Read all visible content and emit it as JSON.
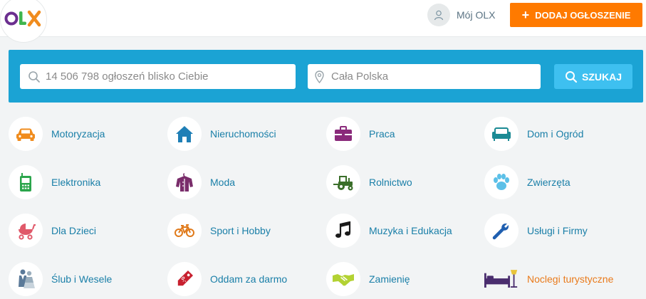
{
  "header": {
    "logo_text": "OLX",
    "my_olx_label": "Mój OLX",
    "add_button_label": "DODAJ OGŁOSZENIE",
    "add_button_plus": "+"
  },
  "search": {
    "query_placeholder": "14 506 798 ogłoszeń blisko Ciebie",
    "location_placeholder": "Cała Polska",
    "button_label": "SZUKAJ"
  },
  "colors": {
    "brand_orange": "#ff7a00",
    "search_bar": "#1ba3d4",
    "search_button": "#3ec0f0",
    "category_link": "#1a7fa8"
  },
  "categories": [
    {
      "label": "Motoryzacja",
      "icon": "car-icon"
    },
    {
      "label": "Nieruchomości",
      "icon": "house-icon"
    },
    {
      "label": "Praca",
      "icon": "briefcase-icon"
    },
    {
      "label": "Dom i Ogród",
      "icon": "sofa-icon"
    },
    {
      "label": "Elektronika",
      "icon": "phone-icon"
    },
    {
      "label": "Moda",
      "icon": "shirt-icon"
    },
    {
      "label": "Rolnictwo",
      "icon": "tractor-icon"
    },
    {
      "label": "Zwierzęta",
      "icon": "paw-icon"
    },
    {
      "label": "Dla Dzieci",
      "icon": "stroller-icon"
    },
    {
      "label": "Sport i Hobby",
      "icon": "bicycle-icon"
    },
    {
      "label": "Muzyka i Edukacja",
      "icon": "music-note-icon"
    },
    {
      "label": "Usługi i Firmy",
      "icon": "wrench-icon"
    },
    {
      "label": "Ślub i Wesele",
      "icon": "wedding-couple-icon"
    },
    {
      "label": "Oddam za darmo",
      "icon": "price-tag-icon"
    },
    {
      "label": "Zamienię",
      "icon": "handshake-icon"
    },
    {
      "label": "Noclegi turystyczne",
      "icon": "bed-icon"
    }
  ]
}
